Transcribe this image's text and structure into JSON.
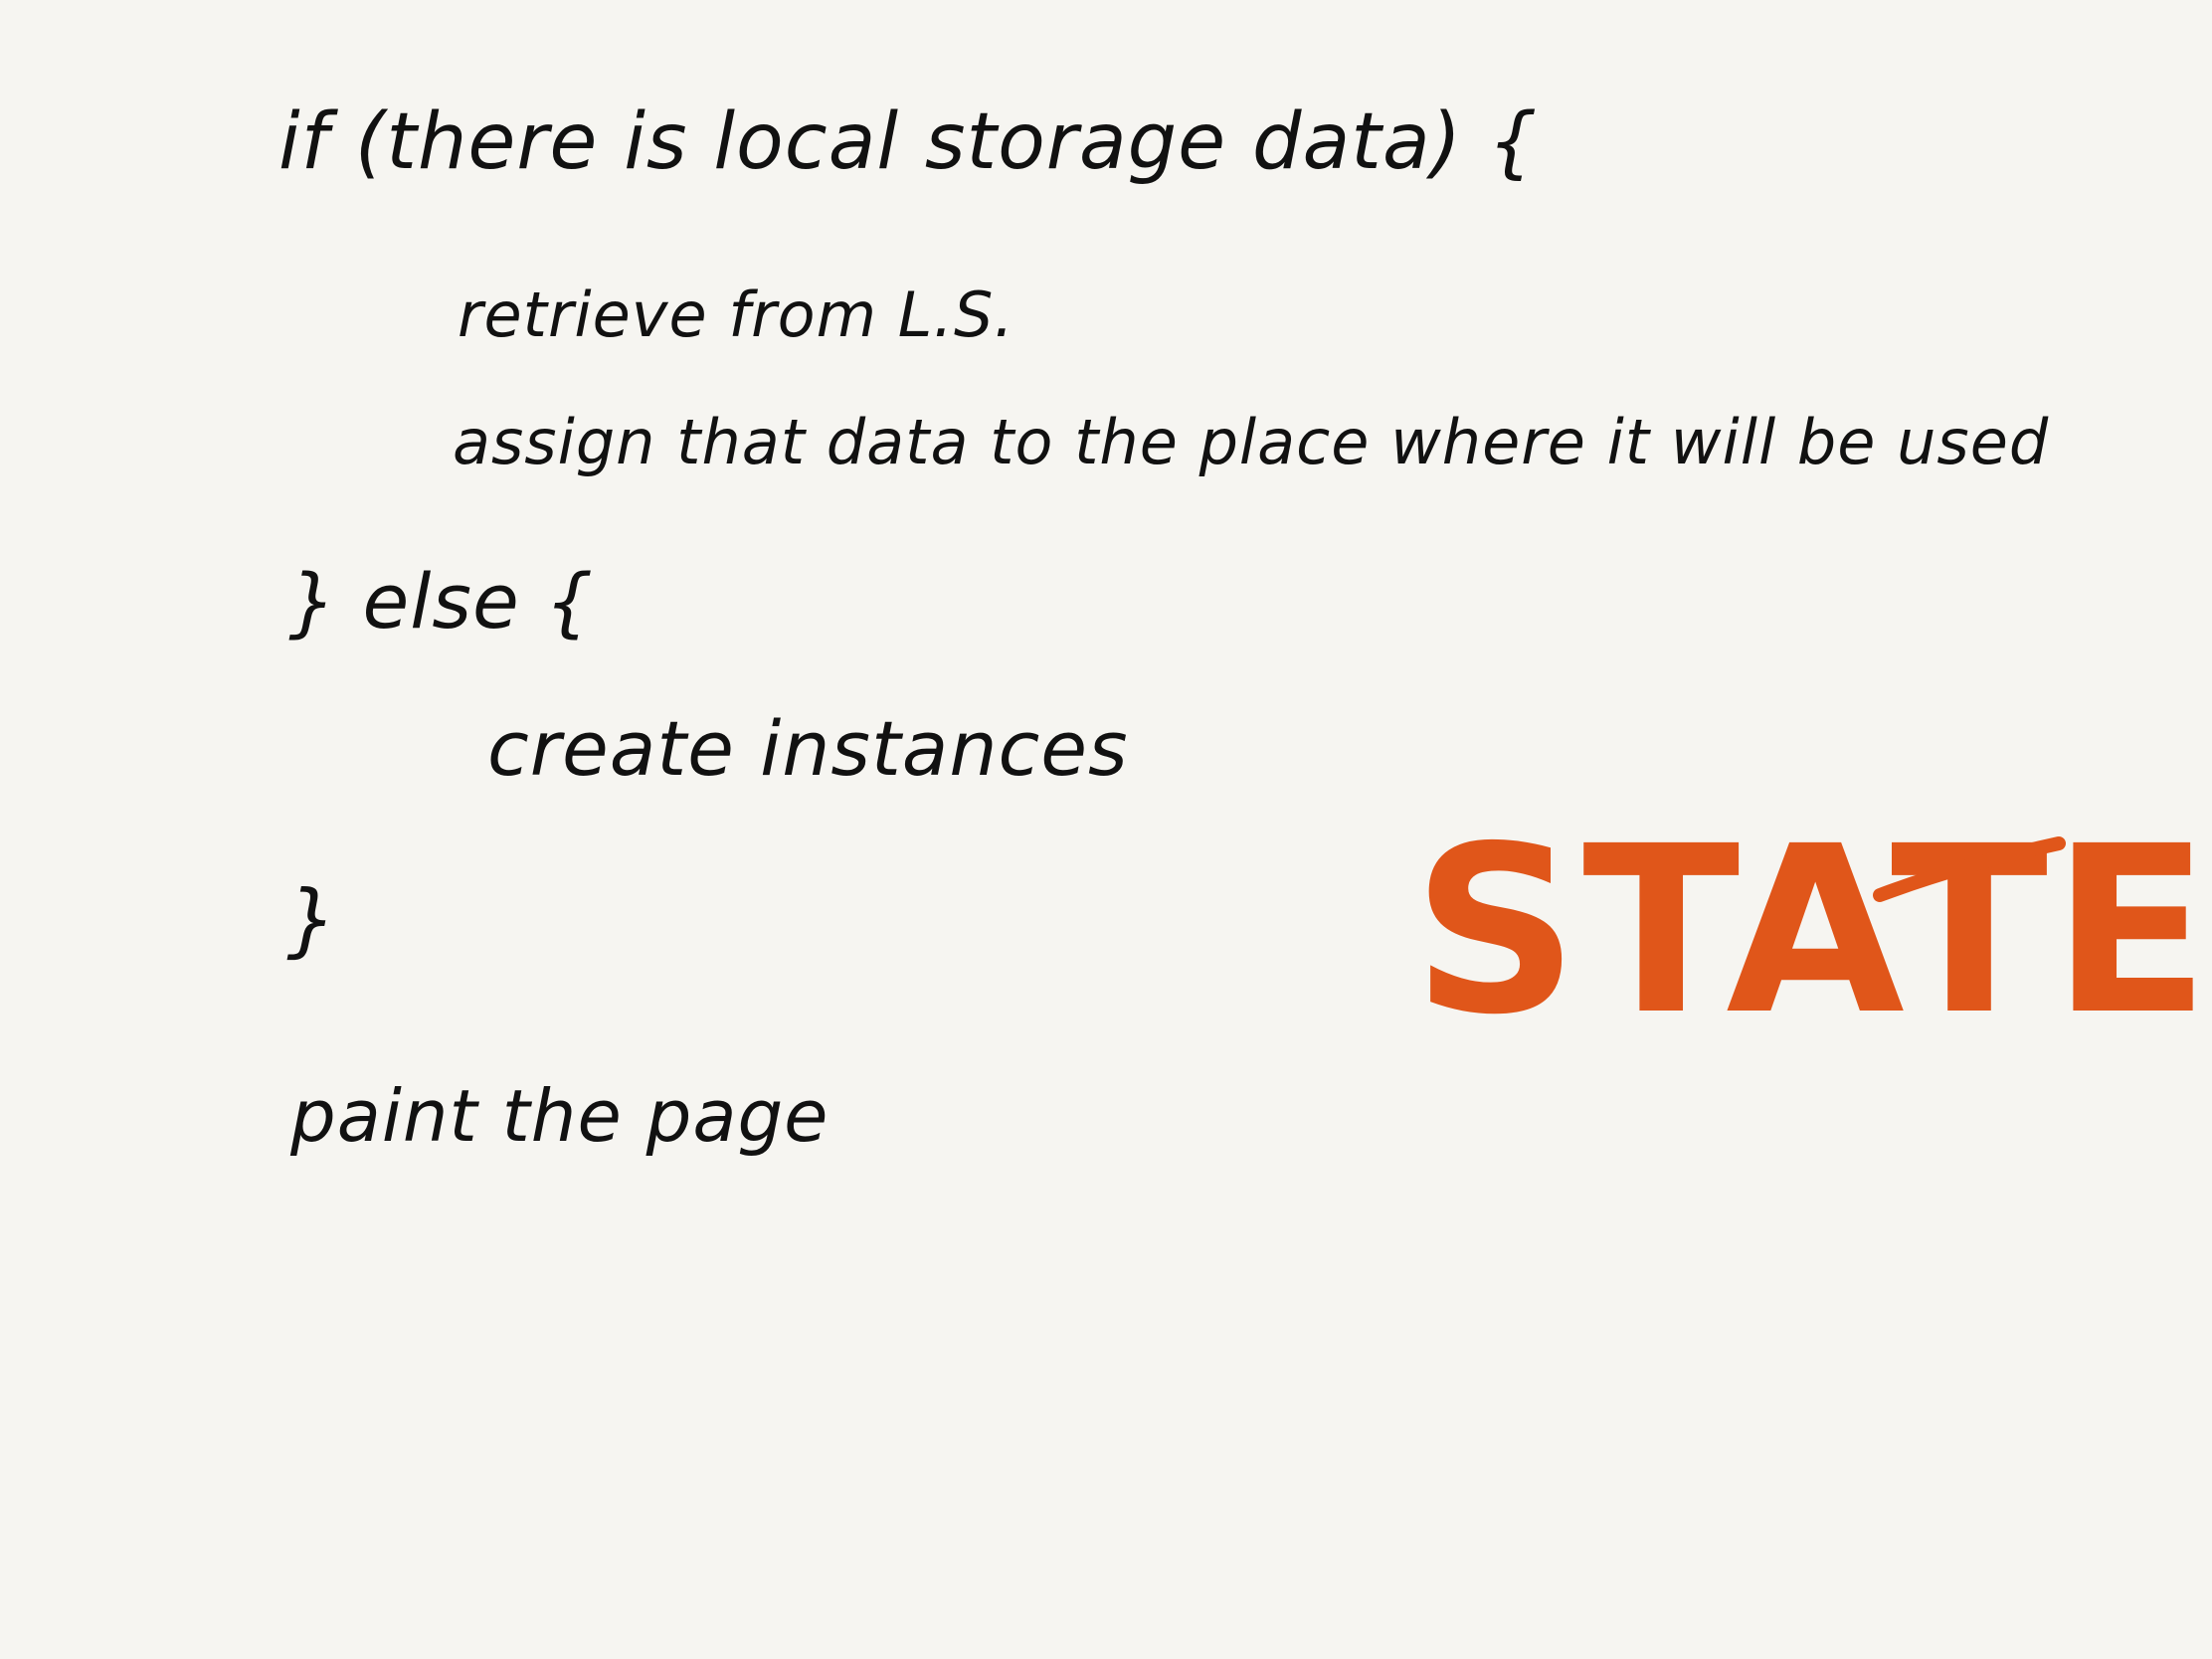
{
  "note": {
    "lines": {
      "if_condition": "if (there is local storage data) {",
      "retrieve": "retrieve from L.S.",
      "assign": "assign that data to the place where it will be used",
      "else": "} else {",
      "create": "create instances",
      "close": "}",
      "paint": "paint the page"
    },
    "label": {
      "text": "STATE",
      "color": "#e0561a"
    },
    "ink_color": "#111111",
    "paper_color": "#f6f5f1"
  }
}
